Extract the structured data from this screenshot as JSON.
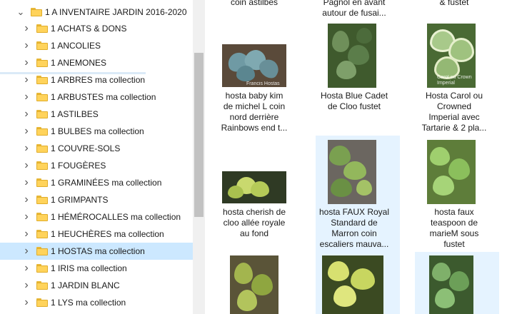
{
  "tree": {
    "items": [
      {
        "label": "1 A INVENTAIRE JARDIN 2016-2020",
        "expanded": true
      },
      {
        "label": "1 ACHATS & DONS"
      },
      {
        "label": "1 ANCOLIES"
      },
      {
        "label": "1 ANEMONES"
      },
      {
        "label": "1 ARBRES ma collection"
      },
      {
        "label": "1 ARBUSTES ma collection"
      },
      {
        "label": "1 ASTILBES"
      },
      {
        "label": "1 BULBES ma collection"
      },
      {
        "label": "1 COUVRE-SOLS"
      },
      {
        "label": "1 FOUGÈRES"
      },
      {
        "label": "1 GRAMINÉES ma collection"
      },
      {
        "label": "1 GRIMPANTS"
      },
      {
        "label": "1 HÉMÉROCALLES ma collection"
      },
      {
        "label": "1 HEUCHÈRES ma collection"
      },
      {
        "label": "1 HOSTAS ma collection",
        "selected": true
      },
      {
        "label": "1 IRIS ma collection"
      },
      {
        "label": "1 JARDIN BLANC"
      },
      {
        "label": "1 LYS ma collection"
      }
    ]
  },
  "files": {
    "top_captions": [
      {
        "line": "coin astilbes"
      },
      {
        "line": "Pagnol en avant"
      },
      {
        "line": "autour de fusai..."
      },
      {
        "line": "& fustet"
      }
    ],
    "row1": [
      {
        "lines": [
          "hosta baby kim",
          "de michel L coin",
          "nord derrière",
          "Rainbows end t..."
        ],
        "watermark": "Francis Hostas"
      },
      {
        "lines": [
          "Hosta Blue Cadet",
          "de Cloo fustet"
        ]
      },
      {
        "lines": [
          "Hosta Carol  ou",
          "Crowned",
          "Imperial avec",
          "Tartarie & 2 pla..."
        ],
        "watermark": "Carol ou Crown Imperial"
      }
    ],
    "row2": [
      {
        "lines": [
          "hosta cherish de",
          "cloo allée royale",
          "au fond"
        ]
      },
      {
        "lines": [
          "hosta FAUX Royal",
          "Standard de",
          "Marron coin",
          "escaliers mauva..."
        ]
      },
      {
        "lines": [
          "hosta faux",
          "teaspoon de",
          "marieM sous",
          "fustet"
        ]
      }
    ]
  }
}
